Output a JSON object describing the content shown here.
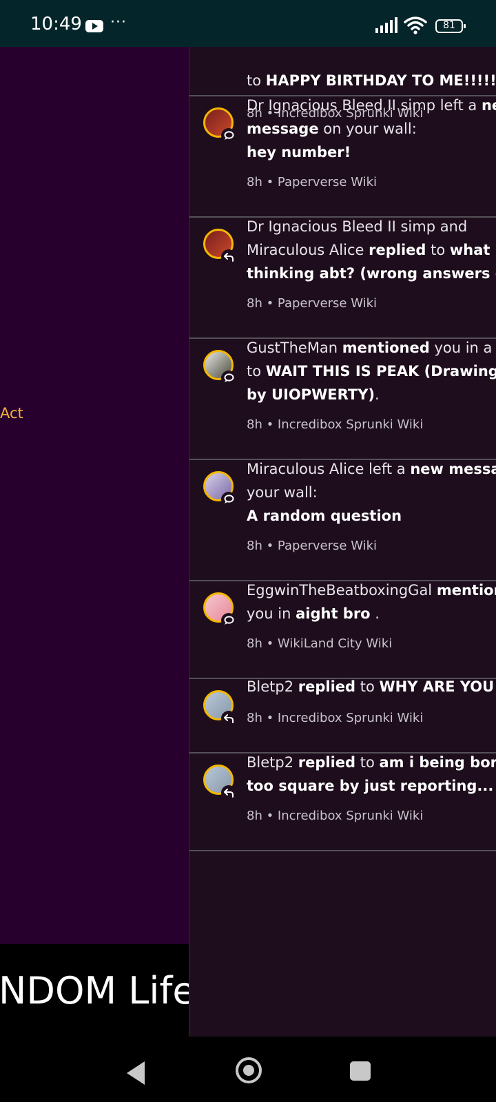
{
  "status_bar": {
    "time": "10:49",
    "more_dots": "···",
    "battery": "81",
    "icons": [
      "youtube-icon",
      "signal-icon",
      "wifi-icon",
      "battery-icon"
    ]
  },
  "background_page": {
    "side_label": "Act",
    "title_fragment": "NDOM Lifes"
  },
  "notifications": [
    {
      "avatar_colors": [
        "#d8c8a8",
        "#a8b8c8"
      ],
      "badge_icon": "speech-bubble-icon",
      "parts": [
        {
          "t": "to ",
          "b": false
        },
        {
          "t": "HAPPY BIRTHDAY TO ME!!!!!!!!",
          "b": true
        }
      ],
      "meta": "8h • Incredibox Sprunki Wiki"
    },
    {
      "avatar_colors": [
        "#7a1e1e",
        "#c84a2a"
      ],
      "badge_icon": "speech-bubble-icon",
      "lines": [
        [
          {
            "t": "Dr Ignacious Bleed II simp left a ",
            "b": false
          },
          {
            "t": "new",
            "b": true
          }
        ],
        [
          {
            "t": "message",
            "b": true
          },
          {
            "t": " on your wall:",
            "b": false
          }
        ],
        [
          {
            "t": "hey number!",
            "b": true
          }
        ]
      ],
      "meta": "8h • Paperverse Wiki"
    },
    {
      "avatar_colors": [
        "#7a1e1e",
        "#c84a2a"
      ],
      "badge_icon": "reply-arrow-icon",
      "lines": [
        [
          {
            "t": "Dr Ignacious Bleed II simp and",
            "b": false
          }
        ],
        [
          {
            "t": "Miraculous Alice ",
            "b": false
          },
          {
            "t": "replied",
            "b": true
          },
          {
            "t": " to ",
            "b": false
          },
          {
            "t": "what is",
            "b": true
          }
        ],
        [
          {
            "t": "thinking abt? (wrong answers only",
            "b": true
          }
        ]
      ],
      "meta": "8h • Paperverse Wiki"
    },
    {
      "avatar_colors": [
        "#e8e8e8",
        "#4a4a3a"
      ],
      "badge_icon": "speech-bubble-icon",
      "lines": [
        [
          {
            "t": "GustTheMan ",
            "b": false
          },
          {
            "t": "mentioned",
            "b": true
          },
          {
            "t": " you in a re",
            "b": false
          }
        ],
        [
          {
            "t": "to ",
            "b": false
          },
          {
            "t": "WAIT THIS IS PEAK (Drawing ma",
            "b": true
          }
        ],
        [
          {
            "t": "by UIOPWERTY)",
            "b": true
          },
          {
            "t": ".",
            "b": false
          }
        ]
      ],
      "meta": "8h • Incredibox Sprunki Wiki"
    },
    {
      "avatar_colors": [
        "#d8d0e8",
        "#7a6aa8"
      ],
      "badge_icon": "speech-bubble-icon",
      "lines": [
        [
          {
            "t": "Miraculous Alice left a ",
            "b": false
          },
          {
            "t": "new messag",
            "b": true
          }
        ],
        [
          {
            "t": "your wall:",
            "b": false
          }
        ],
        [
          {
            "t": "A random question",
            "b": true
          }
        ]
      ],
      "meta": "8h • Paperverse Wiki"
    },
    {
      "avatar_colors": [
        "#f4c8d0",
        "#e88898"
      ],
      "badge_icon": "speech-bubble-icon",
      "lines": [
        [
          {
            "t": "EggwinTheBeatboxingGal ",
            "b": false
          },
          {
            "t": "mention",
            "b": true
          }
        ],
        [
          {
            "t": "you in ",
            "b": false
          },
          {
            "t": "aight bro",
            "b": true
          },
          {
            "t": " .",
            "b": false
          }
        ]
      ],
      "meta": "8h • WikiLand City Wiki"
    },
    {
      "avatar_colors": [
        "#b8c8d8",
        "#8898a8"
      ],
      "badge_icon": "reply-arrow-icon",
      "lines": [
        [
          {
            "t": "Bletp2 ",
            "b": false
          },
          {
            "t": "replied",
            "b": true
          },
          {
            "t": " to ",
            "b": false
          },
          {
            "t": "WHY ARE YOU BL",
            "b": true
          }
        ]
      ],
      "meta": "8h • Incredibox Sprunki Wiki"
    },
    {
      "avatar_colors": [
        "#b8c8d8",
        "#8898a8"
      ],
      "badge_icon": "reply-arrow-icon",
      "lines": [
        [
          {
            "t": "Bletp2 ",
            "b": false
          },
          {
            "t": "replied",
            "b": true
          },
          {
            "t": " to ",
            "b": false
          },
          {
            "t": "am i being boring",
            "b": true
          }
        ],
        [
          {
            "t": "too square by just reporting...",
            "b": true
          }
        ]
      ],
      "meta": "8h • Incredibox Sprunki Wiki"
    }
  ],
  "nav_bar": {
    "icons": [
      "back-icon",
      "home-icon",
      "recents-icon"
    ]
  }
}
